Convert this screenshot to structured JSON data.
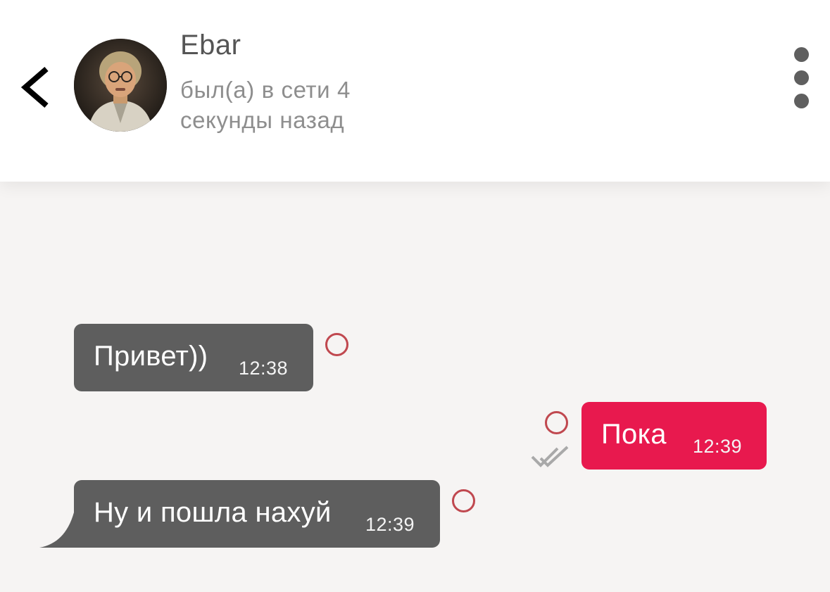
{
  "header": {
    "contact_name": "Ebar",
    "status_line1": "был(а) в сети 4",
    "status_line2": "секунды назад"
  },
  "icons": {
    "back": "chevron-left-icon",
    "more": "vertical-dots-icon",
    "read_receipt": "double-check-icon",
    "select": "circle-icon"
  },
  "colors": {
    "incoming_bubble": "#5e5e5e",
    "outgoing_bubble": "#e8194e",
    "select_circle": "#c0484f",
    "background": "#f6f4f3"
  },
  "messages": [
    {
      "direction": "incoming",
      "text": "Привет))",
      "time": "12:38"
    },
    {
      "direction": "outgoing",
      "text": "Пока",
      "time": "12:39",
      "status": "read"
    },
    {
      "direction": "incoming",
      "text": "Ну и пошла нахуй",
      "time": "12:39"
    }
  ]
}
